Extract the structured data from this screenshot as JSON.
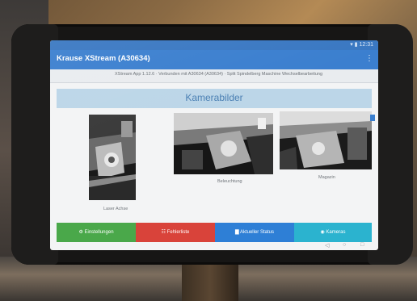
{
  "app": {
    "title": "Krause XStream (A30634)",
    "menu_icon": "more-vert-icon",
    "status_right": "▾ ▮ 12:31"
  },
  "info_line": "XStream App 1.12.6 · Verbunden mit A30634 (A30634) · Split Spindelberg Maschine Wechselbearbeitung",
  "page": {
    "heading": "Kamerabilder"
  },
  "cameras": [
    {
      "caption": "Laser Achse"
    },
    {
      "caption": "Beleuchtung"
    },
    {
      "caption": "Magazin"
    }
  ],
  "buttons": [
    {
      "label": "⚙ Einstellungen",
      "color": "#4aa84a"
    },
    {
      "label": "☷ Fehlerliste",
      "color": "#d9433a"
    },
    {
      "label": "▇ Aktueller Status",
      "color": "#2e7fd6"
    },
    {
      "label": "◉ Kameras",
      "color": "#2bb3cf"
    }
  ],
  "nav": {
    "back_icon": "back-icon",
    "home_icon": "home-icon",
    "recent_icon": "recent-apps-icon"
  }
}
